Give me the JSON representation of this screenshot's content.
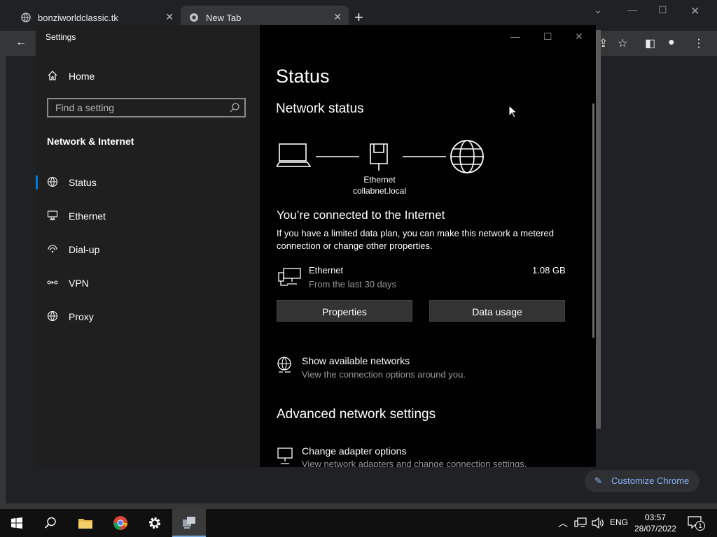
{
  "chrome": {
    "tabs": [
      {
        "title": "bonziworldclassic.tk"
      },
      {
        "title": "New Tab"
      }
    ],
    "customize_label": "Customize Chrome"
  },
  "settings": {
    "window_title": "Settings",
    "home_label": "Home",
    "search_placeholder": "Find a setting",
    "section_title": "Network & Internet",
    "nav": [
      {
        "label": "Status",
        "icon": "status-globe-icon"
      },
      {
        "label": "Ethernet",
        "icon": "ethernet-icon"
      },
      {
        "label": "Dial-up",
        "icon": "dialup-icon"
      },
      {
        "label": "VPN",
        "icon": "vpn-icon"
      },
      {
        "label": "Proxy",
        "icon": "proxy-globe-icon"
      }
    ],
    "page_title": "Status",
    "network_status_heading": "Network status",
    "adapter_name": "Ethernet",
    "adapter_domain": "collabnet.local",
    "connected_heading": "You’re connected to the Internet",
    "connected_text": "If you have a limited data plan, you can make this network a metered connection or change other properties.",
    "usage": {
      "name": "Ethernet",
      "period": "From the last 30 days",
      "amount": "1.08 GB"
    },
    "properties_button": "Properties",
    "data_usage_button": "Data usage",
    "show_networks": {
      "title": "Show available networks",
      "desc": "View the connection options around you."
    },
    "advanced_heading": "Advanced network settings",
    "adapter_options": {
      "title": "Change adapter options",
      "desc": "View network adapters and change connection settings."
    }
  },
  "taskbar": {
    "language": "ENG",
    "time": "03:57",
    "date": "28/07/2022",
    "notification_count": "1"
  },
  "colors": {
    "accent": "#0078d7",
    "link": "#8ab4f8"
  }
}
